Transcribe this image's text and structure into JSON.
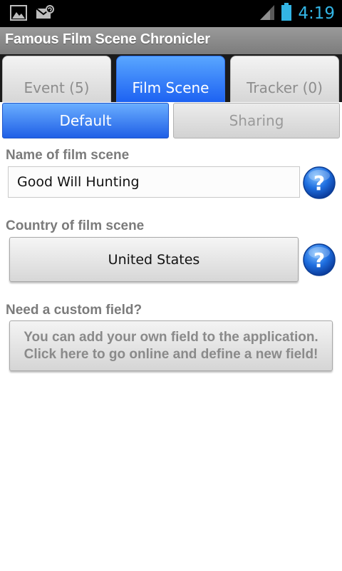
{
  "status_bar": {
    "time": "4:19",
    "left_icons": [
      "image-icon",
      "sync-mail-icon"
    ],
    "right_icons": [
      "signal-icon",
      "battery-icon"
    ],
    "accent_color": "#33b5e5"
  },
  "app": {
    "title": "Famous Film Scene Chronicler"
  },
  "tabs": [
    {
      "label": "Event (5)",
      "active": false
    },
    {
      "label": "Film Scene",
      "active": true
    },
    {
      "label": "Tracker (0)",
      "active": false
    }
  ],
  "sub_tabs": [
    {
      "label": "Default",
      "active": true
    },
    {
      "label": "Sharing",
      "active": false
    }
  ],
  "form": {
    "name_label": "Name of film scene",
    "name_value": "Good Will Hunting",
    "country_label": "Country of film scene",
    "country_value": "United States",
    "custom_label": "Need a custom field?",
    "custom_button_line1": "You can add your own field to the application.",
    "custom_button_line2": "Click here to go online and define a new field!"
  },
  "colors": {
    "active_tab": "#1d62f2",
    "help_icon": "#1a63d6"
  }
}
